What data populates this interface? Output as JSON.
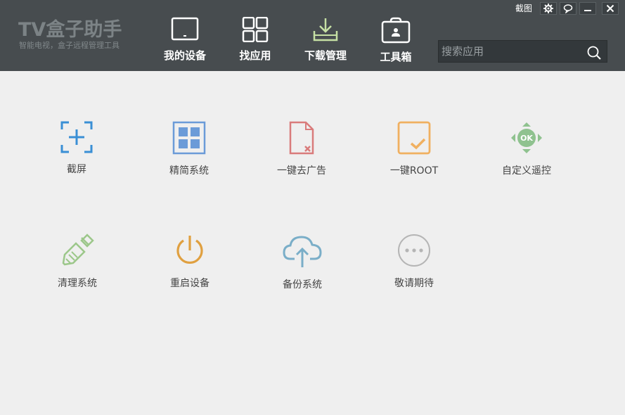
{
  "app": {
    "title": "TV盒子助手",
    "subtitle": "智能电视，盒子远程管理工具"
  },
  "window": {
    "screenshot_label": "截图"
  },
  "nav": [
    {
      "label": "我的设备",
      "icon": "tv-icon"
    },
    {
      "label": "找应用",
      "icon": "grid-icon"
    },
    {
      "label": "下载管理",
      "icon": "download-icon"
    },
    {
      "label": "工具箱",
      "icon": "toolbox-icon"
    }
  ],
  "search": {
    "placeholder": "搜索应用"
  },
  "tools": [
    {
      "label": "截屏",
      "icon": "screenshot-icon",
      "color": "#3a8fd5"
    },
    {
      "label": "精简系统",
      "icon": "windows-grid-icon",
      "color": "#6b9bd8"
    },
    {
      "label": "一键去广告",
      "icon": "remove-ad-icon",
      "color": "#d97b7b"
    },
    {
      "label": "一键ROOT",
      "icon": "root-check-icon",
      "color": "#f0b060"
    },
    {
      "label": "自定义遥控",
      "icon": "remote-dpad-icon",
      "color": "#8fc28f"
    },
    {
      "label": "清理系统",
      "icon": "broom-icon",
      "color": "#9cc78a"
    },
    {
      "label": "重启设备",
      "icon": "power-icon",
      "color": "#e0a040"
    },
    {
      "label": "备份系统",
      "icon": "cloud-upload-icon",
      "color": "#7aaec8"
    },
    {
      "label": "敬请期待",
      "icon": "more-icon",
      "color": "#b5b5b5"
    }
  ]
}
